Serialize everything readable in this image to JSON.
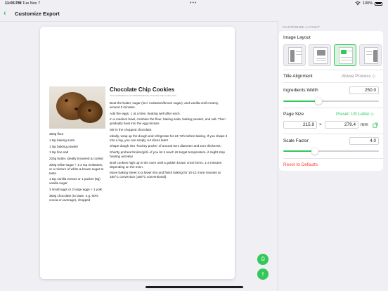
{
  "status": {
    "time": "11:05 PM",
    "date": "Tue Nov 7",
    "battery": "100%"
  },
  "nav": {
    "back_glyph": "‹",
    "title": "Customize Export"
  },
  "recipe": {
    "title": "Chocolate Chip Cookies",
    "url": "www.nestlétollhouse.com/2019/10/ultimate-chocolate-chip-cookies.html",
    "ingredients": [
      "350g flour",
      "1 tsp baking soda",
      "1 tsp baking powder",
      "1 tsp fine salt",
      "225g butter, ideally browned & cooled",
      "300g white sugar + 1-2 tsp molasses, or a mixture of white & brown sugar to taste",
      "1 tsp vanilla extract or 1 packet (8g) vanilla sugar",
      "3 small eggs or 2 large eggs + 1 yolk",
      "350g chocolate (to taste, e.g. 60% cocoa on average), chopped"
    ],
    "steps": [
      "Beat the butter, sugar (incl. molasses/brown sugar), and vanilla until creamy, around 2 minutes.",
      "Add the eggs, 1 at a time, beating well after each.",
      "In a medium bowl, combine the flour, baking soda, baking powder, and salt. Then gradually beat into the egg mixture.",
      "Stir in the chopped chocolate.",
      "Ideally, wrap up the dough and refrigerate for 24-72h before baking. If you shape it into a log, you can simply cut slices later!",
      "Shape dough into \"hockey pucks\" of around 6cm diameter and 2cm thickness.",
      "Shortly preheat broiler/grill—if you let it reach its target temperature, it might stop heating actively!",
      "Broil cookies high up in the oven until a golden brown crust forms, 1-3 minutes depending on the oven.",
      "Move baking sheet to a lower slot and finish baking for 10-12 more minutes at 160°C convection (180°C conventional)."
    ]
  },
  "fabs": {
    "print_glyph": "⎙",
    "share_glyph": "⇪"
  },
  "panel": {
    "section_label": "CUSTOMIZE LAYOUT",
    "image_layout_label": "Image Layout",
    "image_layout_selected_index": 2,
    "title_alignment_label": "Title Alignment",
    "title_alignment_value": "Above Process ◇",
    "ingredients_width_label": "Ingredients Width",
    "ingredients_width_value": "250.0",
    "ingredients_width_fraction": 0.37,
    "page_size_label": "Page Size",
    "page_size_preset": "Preset: US Letter ◇",
    "page_width": "215.9",
    "times": "×",
    "page_height": "279.4",
    "unit": "mm",
    "scale_label": "Scale Factor",
    "scale_value": "4.0",
    "scale_fraction": 0.33,
    "reset_label": "Reset to Defaults",
    "accent": "#34c759",
    "destructive": "#ff3b30"
  }
}
